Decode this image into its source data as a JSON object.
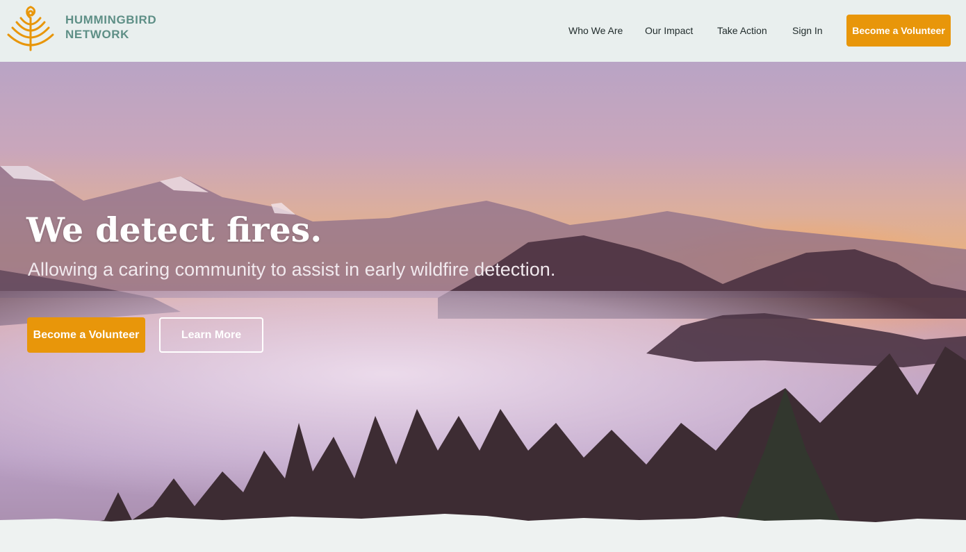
{
  "brand": {
    "line1": "HUMMINGBIRD",
    "line2": "NETWORK"
  },
  "nav": {
    "items": [
      "Who We Are",
      "Our Impact",
      "Take Action",
      "Sign In"
    ],
    "cta": "Become a Volunteer"
  },
  "hero": {
    "title": "We detect fires.",
    "subtitle": "Allowing a caring community to assist in early wildfire detection.",
    "primary_cta": "Become a Volunteer",
    "secondary_cta": "Learn More"
  },
  "icons": {
    "logo": "hummingbird-network-logo-icon"
  },
  "colors": {
    "accent": "#e8960a",
    "brand_text": "#5e8f86",
    "header_bg": "#e9efee"
  }
}
